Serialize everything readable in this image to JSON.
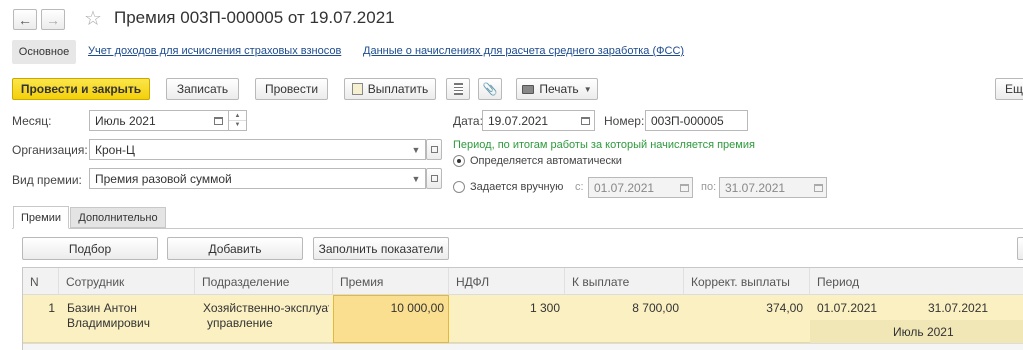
{
  "window": {
    "title": "Премия 003П-000005 от 19.07.2021"
  },
  "nav_tabs": [
    {
      "label": "Основное"
    },
    {
      "label": "Учет доходов для исчисления страховых взносов"
    },
    {
      "label": "Данные о начислениях для расчета среднего заработка (ФСС)"
    }
  ],
  "toolbar": {
    "post_close": "Провести и закрыть",
    "save": "Записать",
    "post": "Провести",
    "pay": "Выплатить",
    "print": "Печать",
    "more": "Ещ"
  },
  "fields": {
    "month_label": "Месяц:",
    "month_value": "Июль 2021",
    "date_label": "Дата:",
    "date_value": "19.07.2021",
    "number_label": "Номер:",
    "number_value": "003П-000005",
    "org_label": "Организация:",
    "org_value": "Крон-Ц",
    "bonus_type_label": "Вид премии:",
    "bonus_type_value": "Премия разовой суммой",
    "period_hint": "Период, по итогам работы за который начисляется премия",
    "radio_auto": "Определяется автоматически",
    "radio_manual": "Задается вручную",
    "from_label": "с:",
    "from_value": "01.07.2021",
    "to_label": "по:",
    "to_value": "31.07.2021"
  },
  "content_tabs": [
    {
      "label": "Премии"
    },
    {
      "label": "Дополнительно"
    }
  ],
  "table_toolbar": {
    "select": "Подбор",
    "add": "Добавить",
    "fill": "Заполнить показатели"
  },
  "table": {
    "columns": [
      "N",
      "Сотрудник",
      "Подразделение",
      "Премия",
      "НДФЛ",
      "К выплате",
      "Коррект. выплаты",
      "Период"
    ],
    "rows": [
      {
        "n": "1",
        "employee_line1": "Базин Антон",
        "employee_line2": "Владимирович",
        "dept_line1": "Хозяйственно-эксплуат",
        "dept_line2": "управление",
        "bonus": "10 000,00",
        "ndfl": "1 300",
        "payout": "8 700,00",
        "correction": "374,00",
        "period_from": "01.07.2021",
        "period_to": "31.07.2021",
        "period_month": "Июль 2021"
      }
    ]
  }
}
